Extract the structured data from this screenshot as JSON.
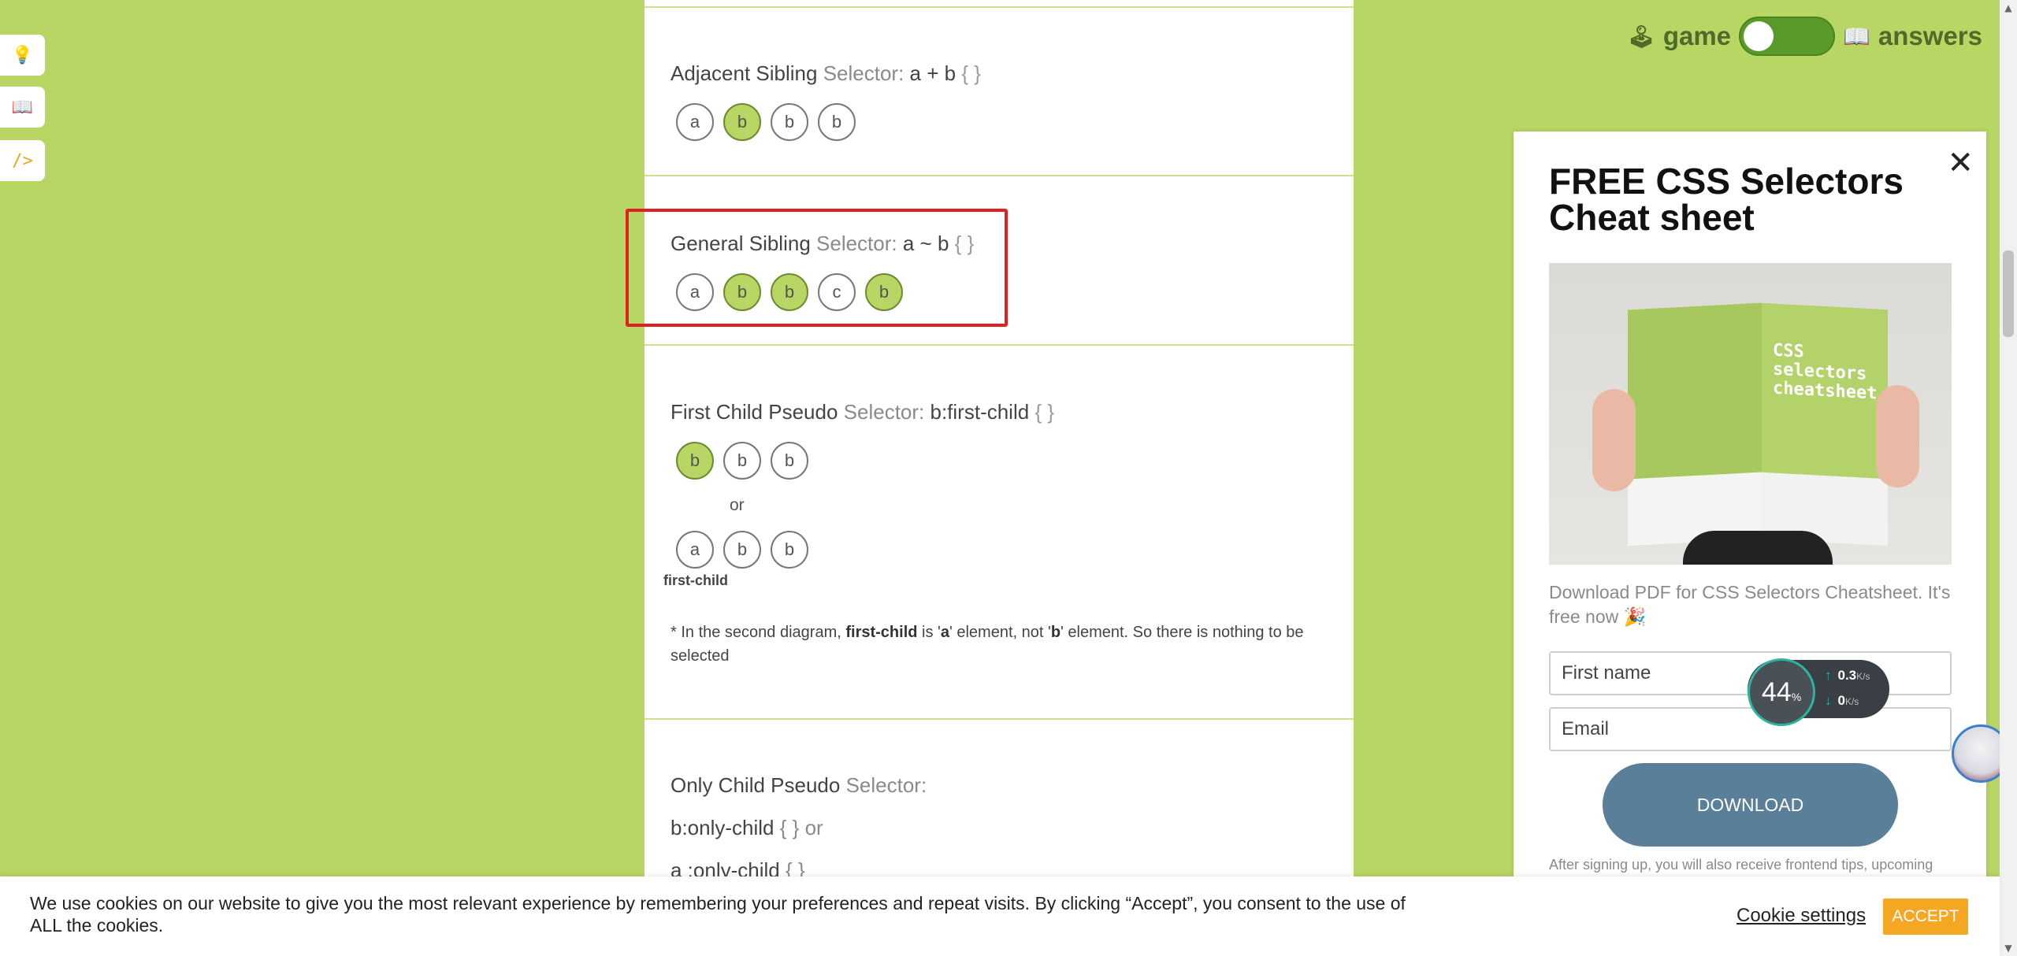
{
  "side_tabs": [
    {
      "icon": "lightbulb-icon",
      "glyph": "💡"
    },
    {
      "icon": "book-icon",
      "glyph": "📖"
    },
    {
      "icon": "code-icon",
      "glyph": "/>"
    }
  ],
  "topbar": {
    "game_icon": "🕹",
    "game_label": "game",
    "answers_icon": "📖",
    "answers_label": "answers"
  },
  "sections": {
    "adjacent": {
      "name": "Adjacent Sibling",
      "selector_word": "Selector:",
      "code": "a + b",
      "braces": "{ }",
      "circles": [
        {
          "label": "a",
          "selected": false
        },
        {
          "label": "b",
          "selected": true
        },
        {
          "label": "b",
          "selected": false
        },
        {
          "label": "b",
          "selected": false
        }
      ]
    },
    "general": {
      "name": "General Sibling",
      "selector_word": "Selector:",
      "code": "a ~ b",
      "braces": "{ }",
      "circles": [
        {
          "label": "a",
          "selected": false
        },
        {
          "label": "b",
          "selected": true
        },
        {
          "label": "b",
          "selected": true
        },
        {
          "label": "c",
          "selected": false
        },
        {
          "label": "b",
          "selected": true
        }
      ]
    },
    "first_child": {
      "name": "First Child Pseudo",
      "selector_word": "Selector:",
      "code": "b:first-child",
      "braces": "{ }",
      "row1": [
        {
          "label": "b",
          "selected": true
        },
        {
          "label": "b",
          "selected": false
        },
        {
          "label": "b",
          "selected": false
        }
      ],
      "or": "or",
      "row2": [
        {
          "label": "a",
          "selected": false
        },
        {
          "label": "b",
          "selected": false
        },
        {
          "label": "b",
          "selected": false
        }
      ],
      "row2_caption": "first-child",
      "note": {
        "prefix": "* In the second diagram, ",
        "term": "first-child",
        "middle1": " is '",
        "el_a": "a",
        "middle2": "' element, not '",
        "el_b": "b",
        "suffix": "' element. So there is nothing to be selected"
      }
    },
    "only_child": {
      "name": "Only Child Pseudo",
      "selector_word": "Selector:",
      "line1_code": "b:only-child",
      "line1_rest": "{ } or",
      "line2_code": "a :only-child",
      "line2_rest": "{ }"
    }
  },
  "popup": {
    "close": "✕",
    "title": "FREE CSS Selectors Cheat sheet",
    "cover_text": "CSS\nselectors\ncheatsheet",
    "description": "Download PDF for CSS Selectors Cheatsheet. It's free now 🎉",
    "first_name_placeholder": "First name",
    "email_placeholder": "Email",
    "download_label": "DOWNLOAD",
    "after_text": "After signing up, you will also receive frontend tips, upcoming"
  },
  "speed_widget": {
    "percent": "44",
    "percent_unit": "%",
    "up_value": "0.3",
    "up_unit": "K/s",
    "down_value": "0",
    "down_unit": "K/s"
  },
  "cookie": {
    "text": "We use cookies on our website to give you the most relevant experience by remembering your preferences and repeat visits. By clicking “Accept”, you consent to the use of ALL the cookies.",
    "settings_label": "Cookie settings",
    "accept_label": "ACCEPT"
  },
  "colors": {
    "page_bg": "#b8d663",
    "selected_circle": "#b8d663",
    "highlight": "#e02020",
    "download_btn": "#5a7f98",
    "accept_btn": "#f5a623"
  }
}
